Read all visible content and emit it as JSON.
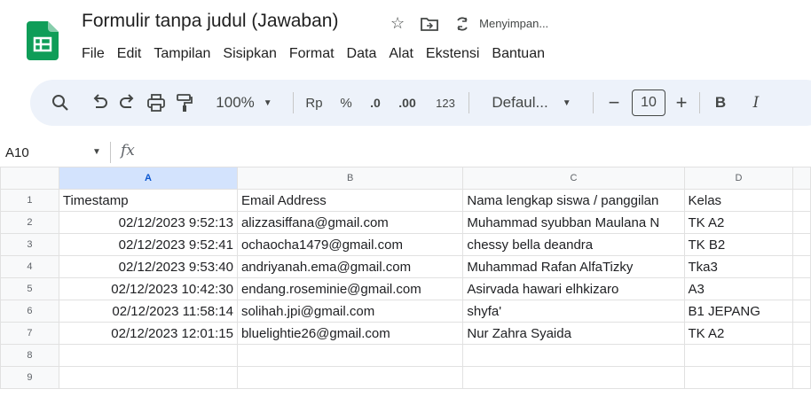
{
  "header": {
    "title": "Formulir tanpa judul (Jawaban)",
    "saving_status": "Menyimpan...",
    "star_icon": "star-icon",
    "folder_icon": "move-to-folder-icon",
    "sync_icon": "sync-icon"
  },
  "menu": [
    "File",
    "Edit",
    "Tampilan",
    "Sisipkan",
    "Format",
    "Data",
    "Alat",
    "Ekstensi",
    "Bantuan"
  ],
  "toolbar": {
    "zoom": "100%",
    "currency": "Rp",
    "percent": "%",
    "decrease_decimal": ".0",
    "increase_decimal": ".00",
    "number_format": "123",
    "font": "Defaul...",
    "minus": "−",
    "font_size": "10",
    "plus": "+",
    "bold": "B"
  },
  "formula_bar": {
    "cell_ref": "A10",
    "fx": "fx"
  },
  "columns": [
    "A",
    "B",
    "C",
    "D"
  ],
  "rows": [
    {
      "num": "1",
      "cells": [
        "Timestamp",
        "Email Address",
        "Nama lengkap siswa / panggilan",
        "Kelas"
      ]
    },
    {
      "num": "2",
      "cells": [
        "02/12/2023 9:52:13",
        "alizzasiffana@gmail.com",
        "Muhammad syubban Maulana N",
        "TK A2"
      ]
    },
    {
      "num": "3",
      "cells": [
        "02/12/2023 9:52:41",
        "ochaocha1479@gmail.com",
        " chessy bella deandra",
        "TK B2"
      ]
    },
    {
      "num": "4",
      "cells": [
        "02/12/2023 9:53:40",
        "andriyanah.ema@gmail.com",
        "Muhammad Rafan AlfaTizky",
        "Tka3"
      ]
    },
    {
      "num": "5",
      "cells": [
        "02/12/2023 10:42:30",
        "endang.roseminie@gmail.com",
        "Asirvada hawari elhkizaro",
        "A3"
      ]
    },
    {
      "num": "6",
      "cells": [
        "02/12/2023 11:58:14",
        "solihah.jpi@gmail.com",
        "shyfa'",
        "B1 JEPANG"
      ]
    },
    {
      "num": "7",
      "cells": [
        "02/12/2023 12:01:15",
        "bluelightie26@gmail.com",
        "Nur Zahra Syaida",
        "TK A2"
      ]
    },
    {
      "num": "8",
      "cells": [
        "",
        "",
        "",
        ""
      ]
    },
    {
      "num": "9",
      "cells": [
        "",
        "",
        "",
        ""
      ]
    }
  ]
}
